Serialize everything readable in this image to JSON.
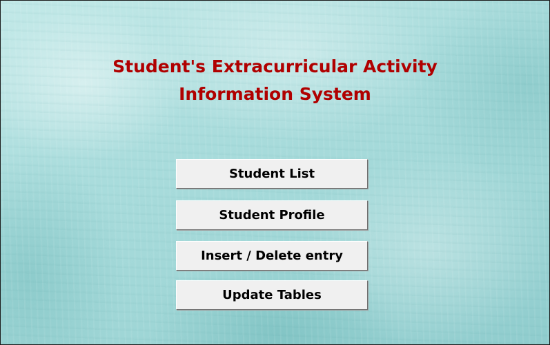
{
  "title": {
    "line1": "Student's Extracurricular Activity",
    "line2": "Information System"
  },
  "buttons": {
    "student_list": "Student List",
    "student_profile": "Student Profile",
    "insert_delete": "Insert / Delete entry",
    "update_tables": "Update Tables"
  },
  "colors": {
    "title": "#b00000",
    "background": "#a9dcdc",
    "button_face": "#f0f0f0"
  }
}
